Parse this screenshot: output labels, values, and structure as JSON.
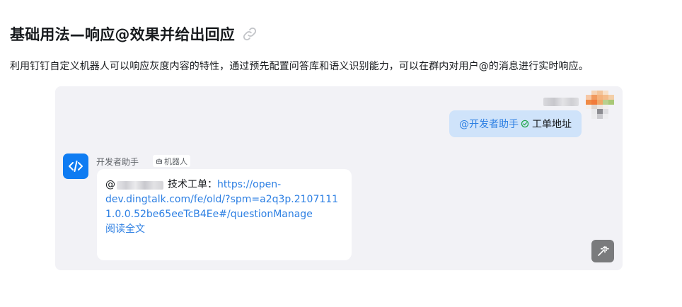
{
  "header": {
    "title": "基础用法—响应@效果并给出回应",
    "description": "利用钉钉自定义机器人可以响应灰度内容的特性，通过预先配置问答库和语义识别能力，可以在群内对用户@的消息进行实时响应。"
  },
  "chat": {
    "user_message": {
      "mention": "@开发者助手",
      "text": "工单地址"
    },
    "bot": {
      "name": "开发者助手",
      "tag": "机器人",
      "message_prefix": "@",
      "message_label": "技术工单：",
      "url": "https://open-dev.dingtalk.com/fe/old/?spm=a2q3p.21071111.0.0.52be65eeTcB4Ee#/questionManage",
      "read_more": "阅读全文"
    }
  },
  "colors": {
    "panel_bg": "#f2f2f6",
    "user_bubble_bg": "#cfe3fa",
    "link": "#2c7fe3",
    "bot_avatar": "#0f7cf2",
    "magic_button": "#7a7b7d"
  },
  "icons": {
    "title_link": "link-icon",
    "verified": "check-circle-icon",
    "bot_avatar": "code-icon",
    "tag": "robot-icon",
    "magic": "magic-wand-icon"
  }
}
